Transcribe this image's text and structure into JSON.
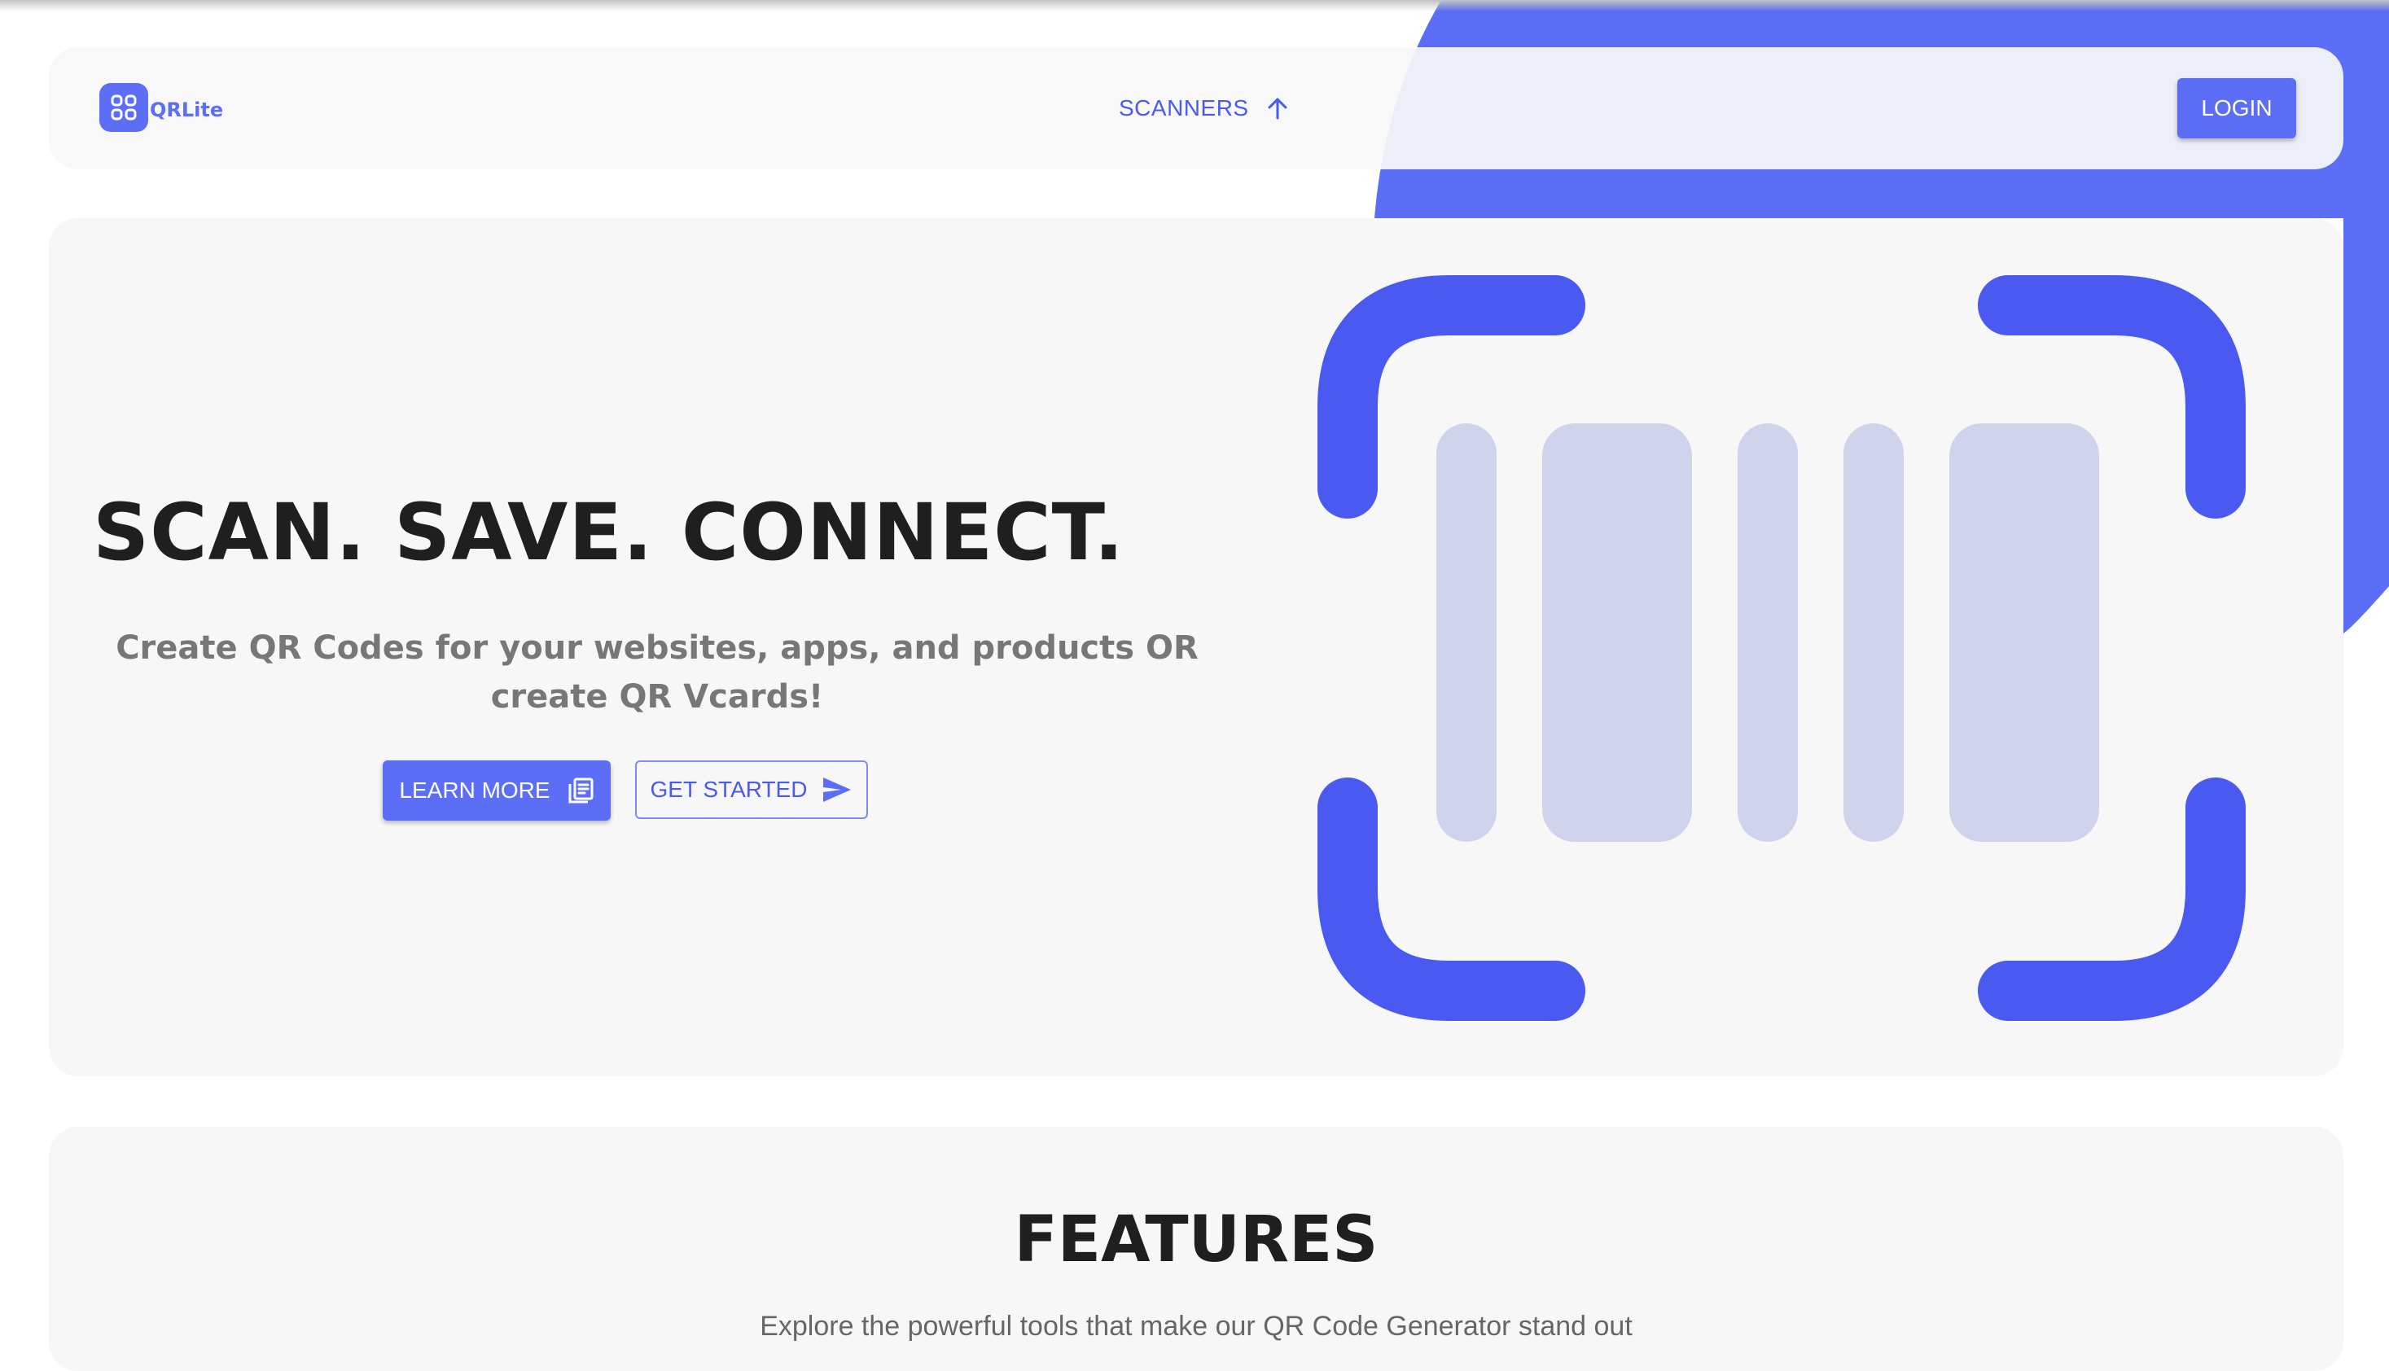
{
  "app": {
    "name": "QRLite",
    "logo_icon": "qr-scan-icon"
  },
  "nav": {
    "scanners_label": "SCANNERS",
    "scanners_icon": "arrow-up-icon",
    "login_label": "LOGIN"
  },
  "hero": {
    "headline": "SCAN. SAVE. CONNECT.",
    "subtitle": "Create QR Codes for your websites, apps, and products OR create QR Vcards!",
    "learn_more_label": "LEARN MORE",
    "learn_more_icon": "document-list-icon",
    "get_started_label": "GET STARTED",
    "get_started_icon": "send-icon",
    "illustration": "barcode-scanner-illustration"
  },
  "features": {
    "title": "FEATURES",
    "description": "Explore the powerful tools that make our QR Code Generator stand out"
  },
  "colors": {
    "accent": "#5b6ef5",
    "accent_dark": "#4a5af0",
    "bar_fill": "#d0d3ec",
    "card_bg": "#f7f7f7",
    "heading": "#1f1f1f",
    "subtitle": "#777777"
  }
}
